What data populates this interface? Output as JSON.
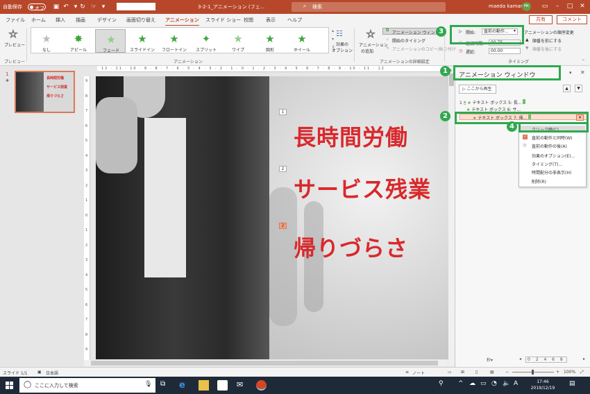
{
  "titlebar": {
    "autosave": "自動保存",
    "autosave_state": "オフ",
    "doc_title": "3-2-1_アニメーション (フェ...",
    "search": "検索",
    "user": "maeda kamari",
    "user_initials": "MK"
  },
  "tabs": [
    "ファイル",
    "ホーム",
    "挿入",
    "描画",
    "デザイン",
    "画面切り替え",
    "アニメーション",
    "スライド ショー",
    "校閲",
    "表示",
    "ヘルプ"
  ],
  "active_tab": "アニメーション",
  "share": "共有",
  "comment": "コメント",
  "ribbon": {
    "preview": "プレビュー",
    "preview_group": "プレビュー",
    "animations": [
      "なし",
      "アピール",
      "フェード",
      "スライドイン",
      "フロートイン",
      "スプリット",
      "ワイプ",
      "図形",
      "ホイール"
    ],
    "selected_animation": "フェード",
    "animation_group": "アニメーション",
    "effect_options": "効果の",
    "effect_options2": "オプション",
    "add_animation": "アニメーション",
    "add_animation2": "の追加",
    "anim_pane_btn": "アニメーション ウィンドウ",
    "trigger": "開始のタイミング",
    "anim_painter": "アニメーションのコピー/貼り付け",
    "advanced_group": "アニメーションの詳細設定",
    "start_label": "開始:",
    "start_value": "直前の動作...",
    "duration_label": "継続時間:",
    "duration_value": "00.75",
    "delay_label": "遅延:",
    "delay_value": "00.00",
    "reorder": "アニメーションの順序変更",
    "move_earlier": "順番を前にする",
    "move_later": "順番を後にする",
    "timing_group": "タイミング"
  },
  "thumbnail": {
    "number": "1",
    "lines": [
      "長時間労働",
      "サービス残業",
      "帰りづらさ"
    ]
  },
  "ruler": {
    "horizontal": "12 · 11 · 10 · 9 · 8 · 7 · 6 · 5 · 4 · 3 · 2 · 1 · 0 · 1 · 2 · 3 · 4 · 5 · 6 · 7 · 8 · 9 · 10 · 11 · 12",
    "vertical": [
      "9",
      "8",
      "7",
      "6",
      "5",
      "4",
      "3",
      "2",
      "1",
      "0",
      "1",
      "2",
      "3",
      "4",
      "5",
      "6",
      "7",
      "8",
      "9"
    ]
  },
  "slide": {
    "lines": [
      "長時間労働",
      "サービス残業",
      "帰りづらさ"
    ],
    "tags": [
      "1",
      "2",
      "2"
    ]
  },
  "pane": {
    "title": "アニメーション ウィンドウ",
    "play_from": "ここから再生",
    "items": [
      {
        "num": "1",
        "label": "テキスト ボックス 5: 長..."
      },
      {
        "num": "",
        "label": "テキスト ボックス 6: サ..."
      },
      {
        "num": "",
        "label": "テキスト ボックス 7: 帰..."
      }
    ],
    "context_menu": [
      "クリック時(C)",
      "直前の動作と同時(W)",
      "直前の動作の後(A)",
      "効果のオプション(E)...",
      "タイミング(T)...",
      "時間配分の非表示(H)",
      "削除(R)"
    ],
    "seconds_label": "秒▾",
    "seconds_scale": "0 2 4 6 8"
  },
  "badges": [
    "1",
    "2",
    "3",
    "4"
  ],
  "status": {
    "slide": "スライド 1/1",
    "language": "日本語",
    "notes": "ノート",
    "zoom": "100%"
  },
  "taskbar": {
    "search": "ここに入力して検索",
    "time": "17:46",
    "date": "2019/12/19"
  },
  "colors": {
    "brand": "#b7472a",
    "callout": "#2fa84f",
    "slide_text": "#d9282c"
  }
}
